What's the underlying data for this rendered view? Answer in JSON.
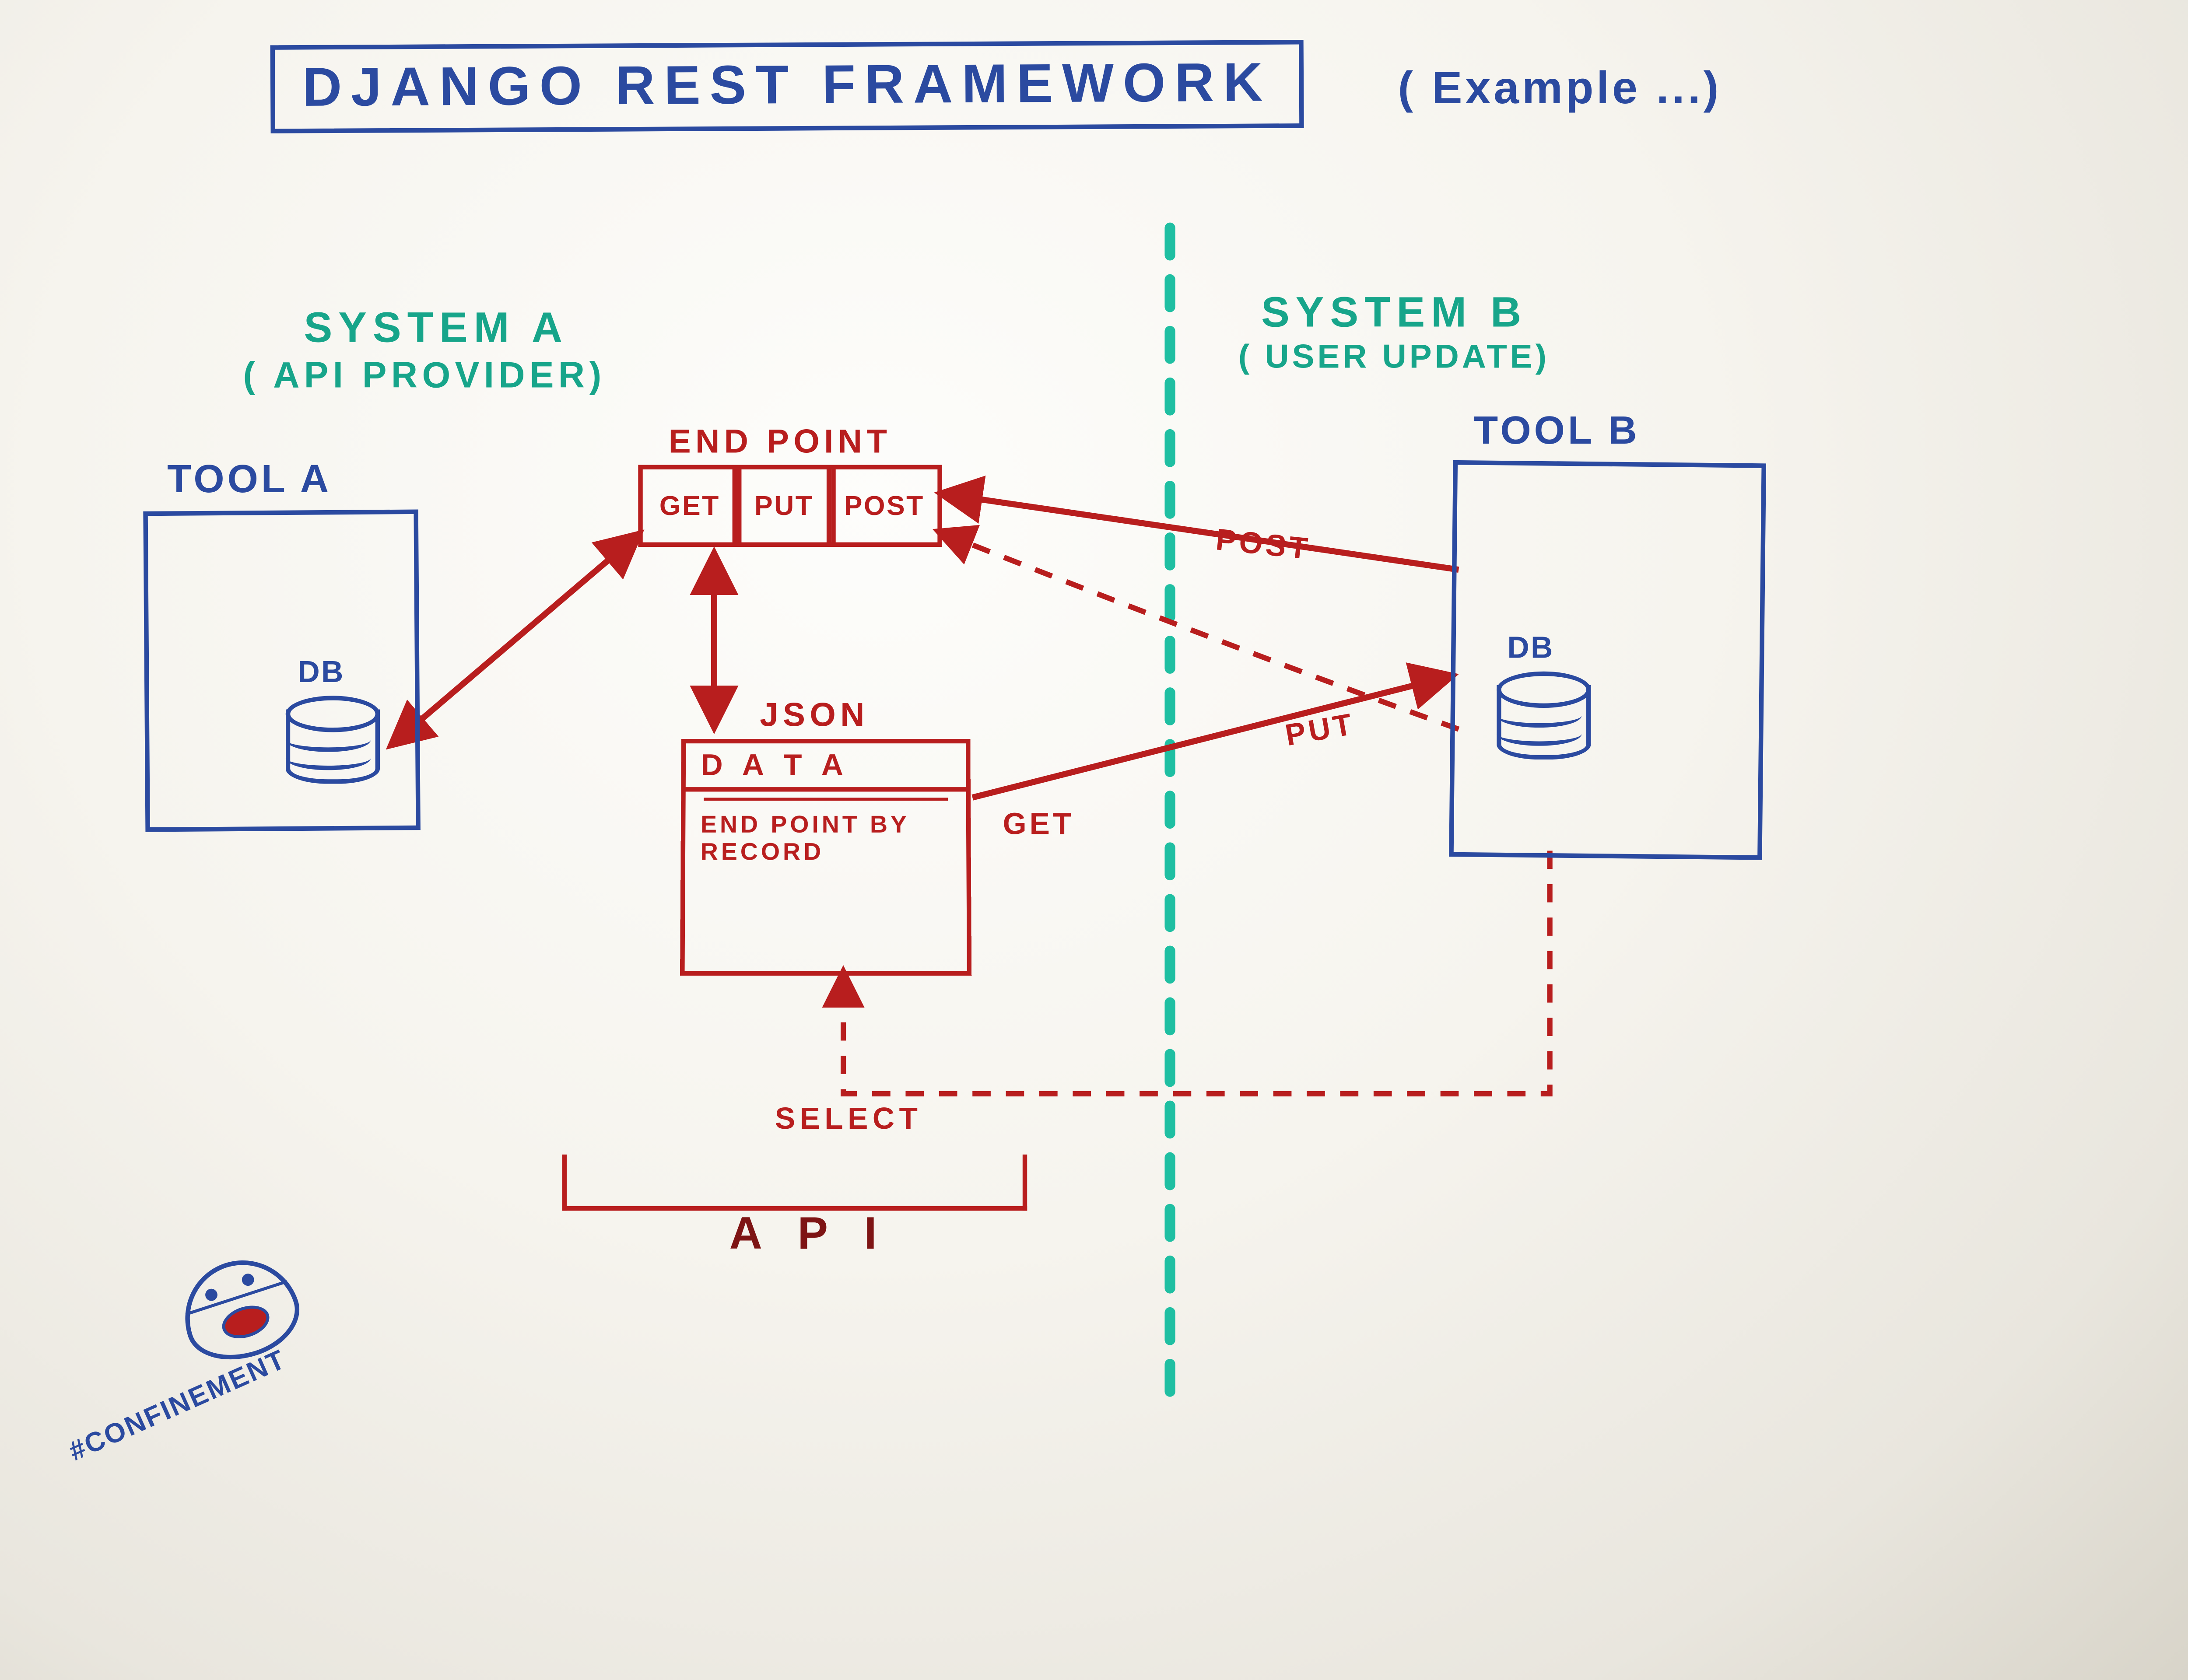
{
  "title": "DJANGO REST FRAMEWORK",
  "title_note": "( Example ...)",
  "system_a": {
    "heading": "SYSTEM A",
    "subheading": "( API PROVIDER)"
  },
  "system_b": {
    "heading": "SYSTEM B",
    "subheading": "( USER UPDATE)"
  },
  "tool_a": {
    "label": "TOOL A",
    "db_label": "DB"
  },
  "tool_b": {
    "label": "TOOL B",
    "db_label": "DB"
  },
  "endpoint": {
    "label": "END POINT",
    "methods": [
      "GET",
      "PUT",
      "POST"
    ]
  },
  "json_box": {
    "title": "JSON",
    "header": "D A T A",
    "line2": "END POINT\nBY RECORD"
  },
  "arrows": {
    "get": "GET",
    "put": "PUT",
    "post": "POST",
    "select": "SELECT"
  },
  "api_bracket": "A P I",
  "hashtag": "#CONFINEMENT",
  "colors": {
    "blue": "#2b4aa0",
    "teal": "#17a58a",
    "red": "#b81e1e"
  }
}
